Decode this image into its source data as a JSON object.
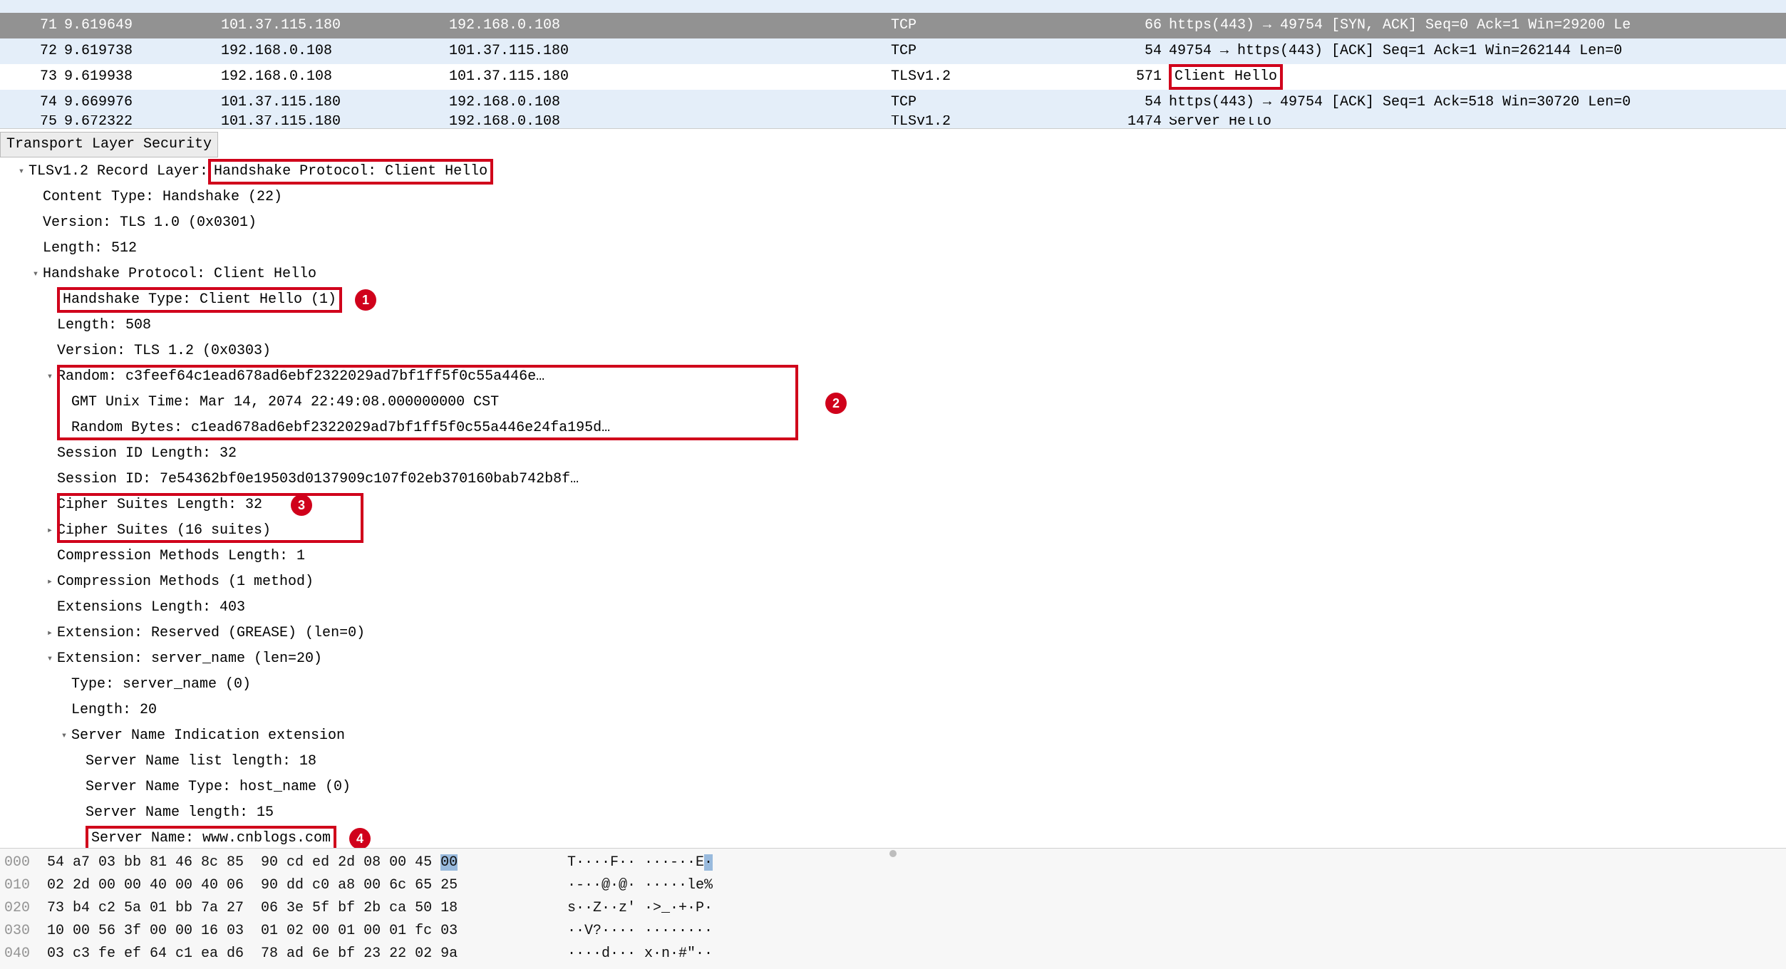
{
  "packets": [
    {
      "no": "71",
      "time": "9.619649",
      "src": "101.37.115.180",
      "dst": "192.168.0.108",
      "prot": "TCP",
      "len": "66",
      "info": "https(443) → 49754 [SYN, ACK] Seq=0 Ack=1 Win=29200 Le",
      "class": "r-sel"
    },
    {
      "no": "72",
      "time": "9.619738",
      "src": "192.168.0.108",
      "dst": "101.37.115.180",
      "prot": "TCP",
      "len": "54",
      "info": "49754 → https(443) [ACK] Seq=1 Ack=1 Win=262144 Len=0",
      "class": "r-tcp"
    },
    {
      "no": "73",
      "time": "9.619938",
      "src": "192.168.0.108",
      "dst": "101.37.115.180",
      "prot": "TLSv1.2",
      "len": "571",
      "info": "Client Hello",
      "class": "r-white",
      "infobox": true
    },
    {
      "no": "74",
      "time": "9.669976",
      "src": "101.37.115.180",
      "dst": "192.168.0.108",
      "prot": "TCP",
      "len": "54",
      "info": "https(443) → 49754 [ACK] Seq=1 Ack=518 Win=30720 Len=0",
      "class": "r-tcp"
    }
  ],
  "packets_cut": {
    "no": "75",
    "time": "9.672322",
    "src": "101.37.115.180",
    "dst": "192.168.0.108",
    "prot": "TLSv1.2",
    "len": "1474",
    "info": "Server Hello"
  },
  "det_header": "Transport Layer Security",
  "det": {
    "record_prefix": "TLSv1.2 Record Layer: ",
    "record_box": "Handshake Protocol: Client Hello",
    "content_type": "Content Type: Handshake (22)",
    "version_rec": "Version: TLS 1.0 (0x0301)",
    "length_rec": "Length: 512",
    "hs_hdr": "Handshake Protocol: Client Hello",
    "hs_type": "Handshake Type: Client Hello (1)",
    "hs_len": "Length: 508",
    "hs_ver": "Version: TLS 1.2 (0x0303)",
    "random": "Random: c3feef64c1ead678ad6ebf2322029ad7bf1ff5f0c55a446e…",
    "gmt": "GMT Unix Time: Mar 14, 2074 22:49:08.000000000 CST",
    "randbytes": "Random Bytes: c1ead678ad6ebf2322029ad7bf1ff5f0c55a446e24fa195d…",
    "sid_len": "Session ID Length: 32",
    "sid": "Session ID: 7e54362bf0e19503d0137909c107f02eb370160bab742b8f…",
    "cs_len": "Cipher Suites Length: 32",
    "cs": "Cipher Suites (16 suites)",
    "cm_len": "Compression Methods Length: 1",
    "cm": "Compression Methods (1 method)",
    "ext_len": "Extensions Length: 403",
    "ext_grease": "Extension: Reserved (GREASE) (len=0)",
    "ext_sni": "Extension: server_name (len=20)",
    "sni_type": "Type: server_name (0)",
    "sni_len": "Length: 20",
    "sni_ext_hdr": "Server Name Indication extension",
    "sni_list_len": "Server Name list length: 18",
    "sni_name_type": "Server Name Type: host_name (0)",
    "sni_name_len": "Server Name length: 15",
    "sni_name": "Server Name: www.cnblogs.com"
  },
  "hex": [
    {
      "off": "000",
      "hex1": "54 a7 03 bb 81 46 8c 85",
      "hex2": "90 cd ed 2d 08 00 45 ",
      "hexhl": "00",
      "asc": "T····F·· ···-··E",
      "aschl": "·"
    },
    {
      "off": "010",
      "hex1": "02 2d 00 00 40 00 40 06",
      "hex2": "90 dd c0 a8 00 6c 65 25",
      "hexhl": "",
      "asc": "·-··@·@· ·····le%",
      "aschl": ""
    },
    {
      "off": "020",
      "hex1": "73 b4 c2 5a 01 bb 7a 27",
      "hex2": "06 3e 5f bf 2b ca 50 18",
      "hexhl": "",
      "asc": "s··Z··z' ·>_·+·P·",
      "aschl": ""
    },
    {
      "off": "030",
      "hex1": "10 00 56 3f 00 00 16 03",
      "hex2": "01 02 00 01 00 01 fc 03",
      "hexhl": "",
      "asc": "··V?···· ········",
      "aschl": ""
    },
    {
      "off": "040",
      "hex1": "03 c3 fe ef 64 c1 ea d6",
      "hex2": "78 ad 6e bf 23 22 02 9a",
      "hexhl": "",
      "asc": "····d··· x·n·#\"··",
      "aschl": ""
    }
  ]
}
